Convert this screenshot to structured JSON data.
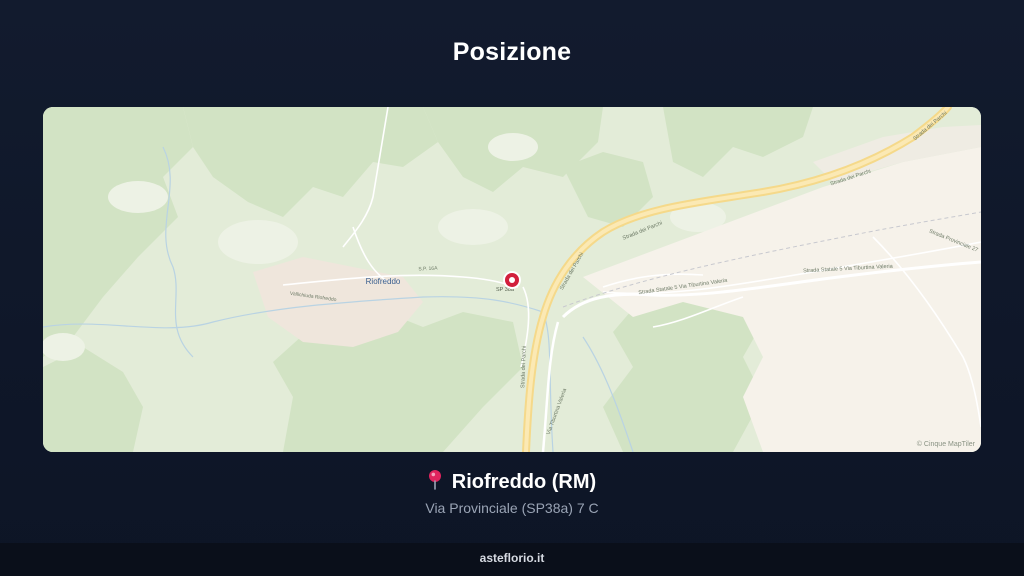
{
  "title": "Posizione",
  "map": {
    "attribution": "© Cinque MapTiler",
    "places": {
      "town": "Riofreddo",
      "locality": "Vallichiuda Riofreddo",
      "road_sp16a": "S.P. 16A",
      "road_sp38a": "SP 38a",
      "parchi_1": "Strada dei Parchi",
      "parchi_2": "Strada dei Parchi",
      "parchi_3": "Strada dei Parchi",
      "parchi_4": "Strada dei Parchi",
      "parchi_5": "Strada dei Parchi",
      "tiburtina_1": "Strada Statale 5 Via Tiburtina Valeria",
      "tiburtina_2": "Strada Statale 5 Via Tiburtina Valeria",
      "tiburtina_3": "Via Tiburtina Valeria",
      "provinciale": "Strada Provinciale 27"
    }
  },
  "location": {
    "name": "Riofreddo (RM)",
    "address": "Via Provinciale (SP38a) 7 C",
    "icon": "map-pin-icon"
  },
  "footer": {
    "site": "asteflorio.it"
  }
}
